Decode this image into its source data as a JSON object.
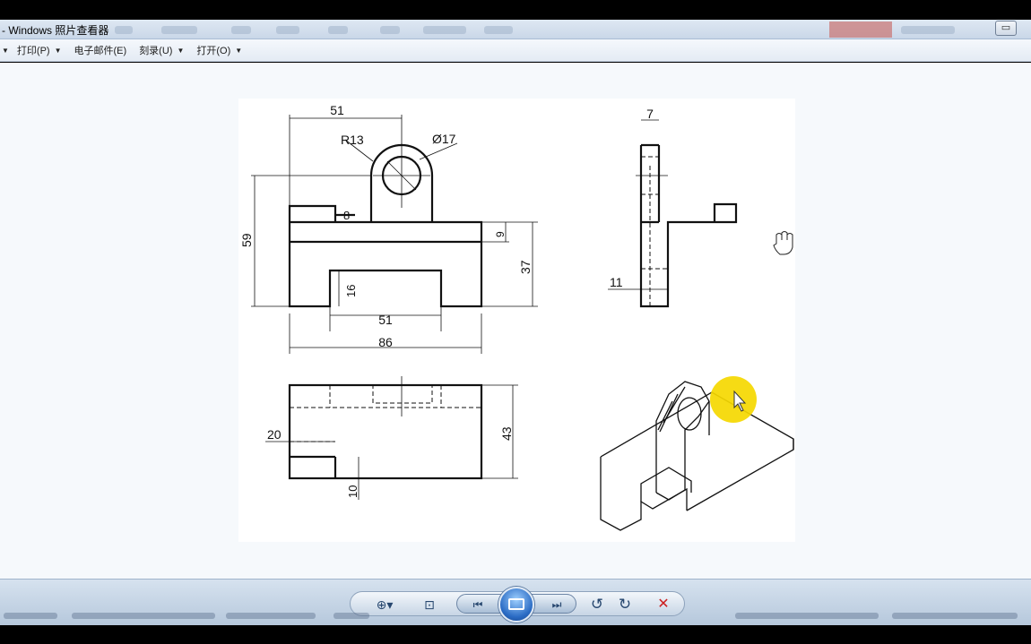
{
  "window": {
    "title": "- Windows 照片查看器",
    "restore_symbol": "▭"
  },
  "menu": {
    "lead_arrow": "▼",
    "items": [
      {
        "label": "打印(P)",
        "arrow": "▼"
      },
      {
        "label": "电子邮件(E)",
        "arrow": ""
      },
      {
        "label": "刻录(U)",
        "arrow": "▼"
      },
      {
        "label": "打开(O)",
        "arrow": "▼"
      }
    ]
  },
  "drawing": {
    "dimensions": {
      "d51_top": "51",
      "r13": "R13",
      "phi17": "Ø17",
      "d8": "8",
      "d59": "59",
      "d9": "9",
      "d37": "37",
      "d16": "16",
      "d51_bottom": "51",
      "d86": "86",
      "d7": "7",
      "d11": "11",
      "d20": "20",
      "d43": "43",
      "d10": "10"
    }
  },
  "toolbar": {
    "zoom_icon": "⊕▾",
    "fit_icon": "⊡",
    "prev_icon": "⏮",
    "next_icon": "⏭",
    "rotate_ccw_icon": "↺",
    "rotate_cw_icon": "↻",
    "delete_icon": "✕"
  },
  "colors": {
    "titlebar": "#dfe8f3",
    "content_bg": "#f6f9fc",
    "cursor_highlight": "#f5d800",
    "delete_red": "#cc1f1f"
  }
}
